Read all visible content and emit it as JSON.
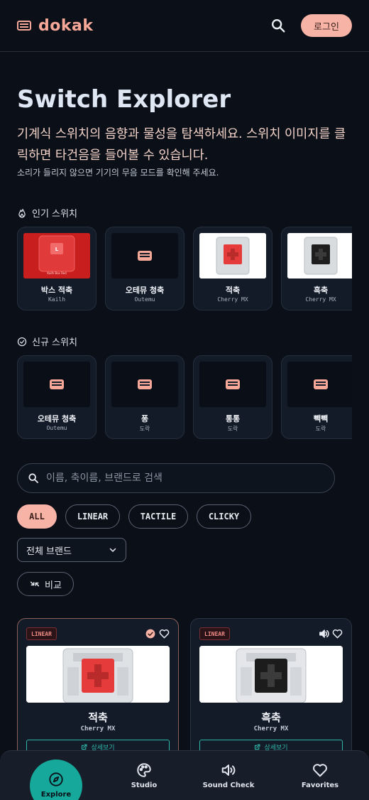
{
  "header": {
    "logo_text": "dokak",
    "login_label": "로그인"
  },
  "hero": {
    "title": "Switch Explorer",
    "description": "기계식 스위치의 음향과 물성을 탐색하세요. 스위치 이미지를 클릭하면 타건음을 들어볼 수 있습니다.",
    "note": "소리가 들리지 않으면 기기의 무음 모드를 확인해 주세요."
  },
  "popular": {
    "label": "인기 스위치",
    "items": [
      {
        "name": "박스 적축",
        "brand": "Kailh",
        "thumb": "kailh-box-red"
      },
      {
        "name": "오테뮤 청축",
        "brand": "Outemu",
        "thumb": "keyboard-icon"
      },
      {
        "name": "적축",
        "brand": "Cherry MX",
        "thumb": "red-switch"
      },
      {
        "name": "흑축",
        "brand": "Cherry MX",
        "thumb": "black-switch"
      }
    ]
  },
  "new": {
    "label": "신규 스위치",
    "items": [
      {
        "name": "오테뮤 청축",
        "brand": "Outemu"
      },
      {
        "name": "퐁",
        "brand": "도락"
      },
      {
        "name": "통통",
        "brand": "도락"
      },
      {
        "name": "빽빽",
        "brand": "도락"
      }
    ]
  },
  "search": {
    "placeholder": "이름, 축이름, 브랜드로 검색"
  },
  "filters": {
    "chips": [
      "ALL",
      "LINEAR",
      "TACTILE",
      "CLICKY"
    ],
    "active": "ALL",
    "brand_select": "전체 브랜드",
    "compare_label": "비교"
  },
  "switch_cards": [
    {
      "type": "LINEAR",
      "name": "적축",
      "brand": "Cherry MX",
      "detail_label": "상세보기",
      "selected": true
    },
    {
      "type": "LINEAR",
      "name": "흑축",
      "brand": "Cherry MX",
      "detail_label": "상세보기",
      "selected": false
    }
  ],
  "nav": {
    "items": [
      "Explore",
      "Studio",
      "Sound Check",
      "Favorites"
    ],
    "active": "Explore"
  },
  "colors": {
    "accent": "#f7b3a6",
    "teal": "#16a89a",
    "background": "#0b1018"
  }
}
